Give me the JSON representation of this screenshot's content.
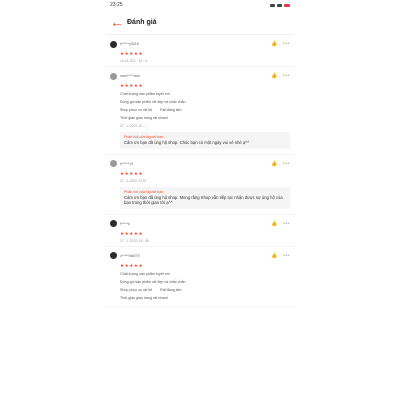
{
  "status": {
    "time": "23:25"
  },
  "header": {
    "title": "Đánh giá"
  },
  "reviews": [
    {
      "user": "h*****y3018",
      "stars": "★★★★★",
      "date": "10-01-202 · 10 : 4"
    },
    {
      "user": "nam*****anh",
      "stars": "★★★★★",
      "attrs": [
        "Chất lượng sản phẩm tuyệt vời",
        "Đóng gói sản phẩm rất đẹp và chắc chắn",
        "Shop phục vụ rất tốt",
        "Rất đáng tiền",
        "Thời gian giao hàng rất nhanh"
      ],
      "date": "27 - 2-2022 15 : --",
      "reply_header": "Phản hồi của Người bán:",
      "reply_text": "Cảm ơn bạn đã ủng hộ shop. Chúc bạn có một ngày vui vẻ nhé ạ^^"
    },
    {
      "user": "h*****19",
      "stars": "★★★★★",
      "date": "27 - 1-2022 17:57",
      "reply_header": "Phản hồi của Người bán:",
      "reply_text": "Cảm ơn bạn đã ủng hộ shop. Mong rằng Shop vẫn tiếp tục nhận được sự ủng hộ của bạn trong thời gian tới ạ^^"
    },
    {
      "user": "t*****k",
      "stars": "★★★★★",
      "date": "27 - 1-2022 13 : 38"
    },
    {
      "user": "c*****la6079",
      "stars": "★★★★★",
      "attrs": [
        "Chất lượng sản phẩm tuyệt vời",
        "Đóng gói sản phẩm rất đẹp và chắc chắn",
        "Shop phục vụ rất tốt",
        "Rất đáng tiền",
        "Thời gian giao hàng rất nhanh"
      ]
    }
  ],
  "icons": {
    "like": "thumbs-up-icon",
    "more": "more-icon"
  }
}
